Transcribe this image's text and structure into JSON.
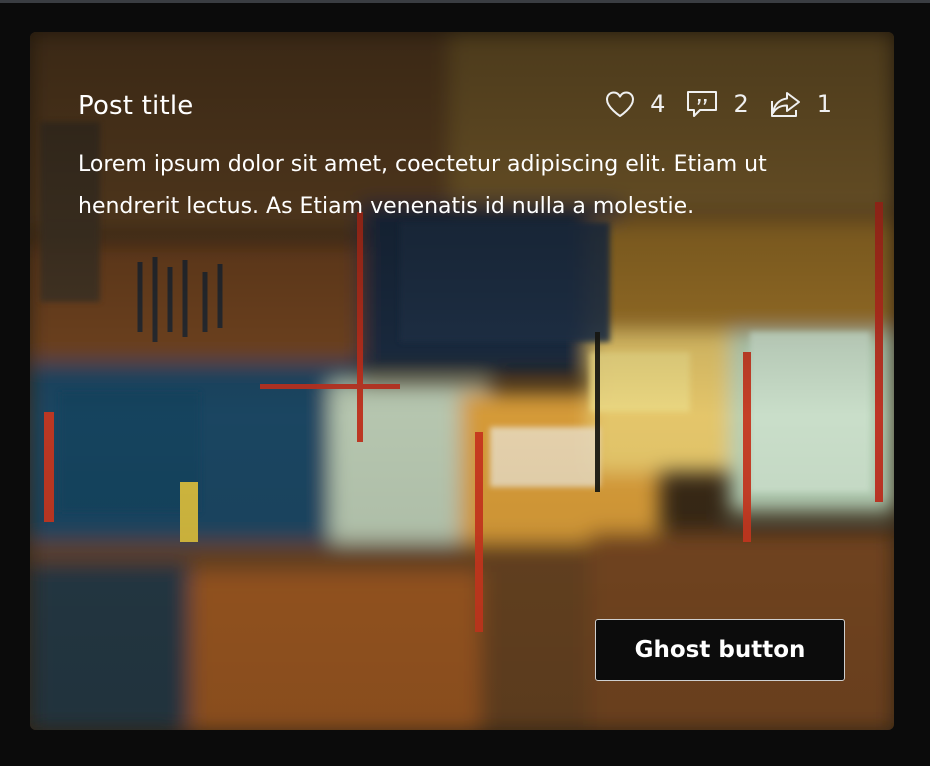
{
  "card": {
    "title": "Post title",
    "body": "Lorem ipsum dolor sit amet, coectetur adipiscing elit. Etiam ut hendrerit lectus. As Etiam venenatis id nulla a molestie.",
    "stats": {
      "likes": {
        "icon": "heart-icon",
        "count": "4"
      },
      "comments": {
        "icon": "comment-icon",
        "count": "2"
      },
      "shares": {
        "icon": "share-icon",
        "count": "1"
      }
    },
    "button_label": "Ghost button"
  },
  "colors": {
    "page_background": "#0b0b0b",
    "text": "#ffffff",
    "button_background": "#0c0c0c",
    "button_border": "#cfcfcf"
  }
}
